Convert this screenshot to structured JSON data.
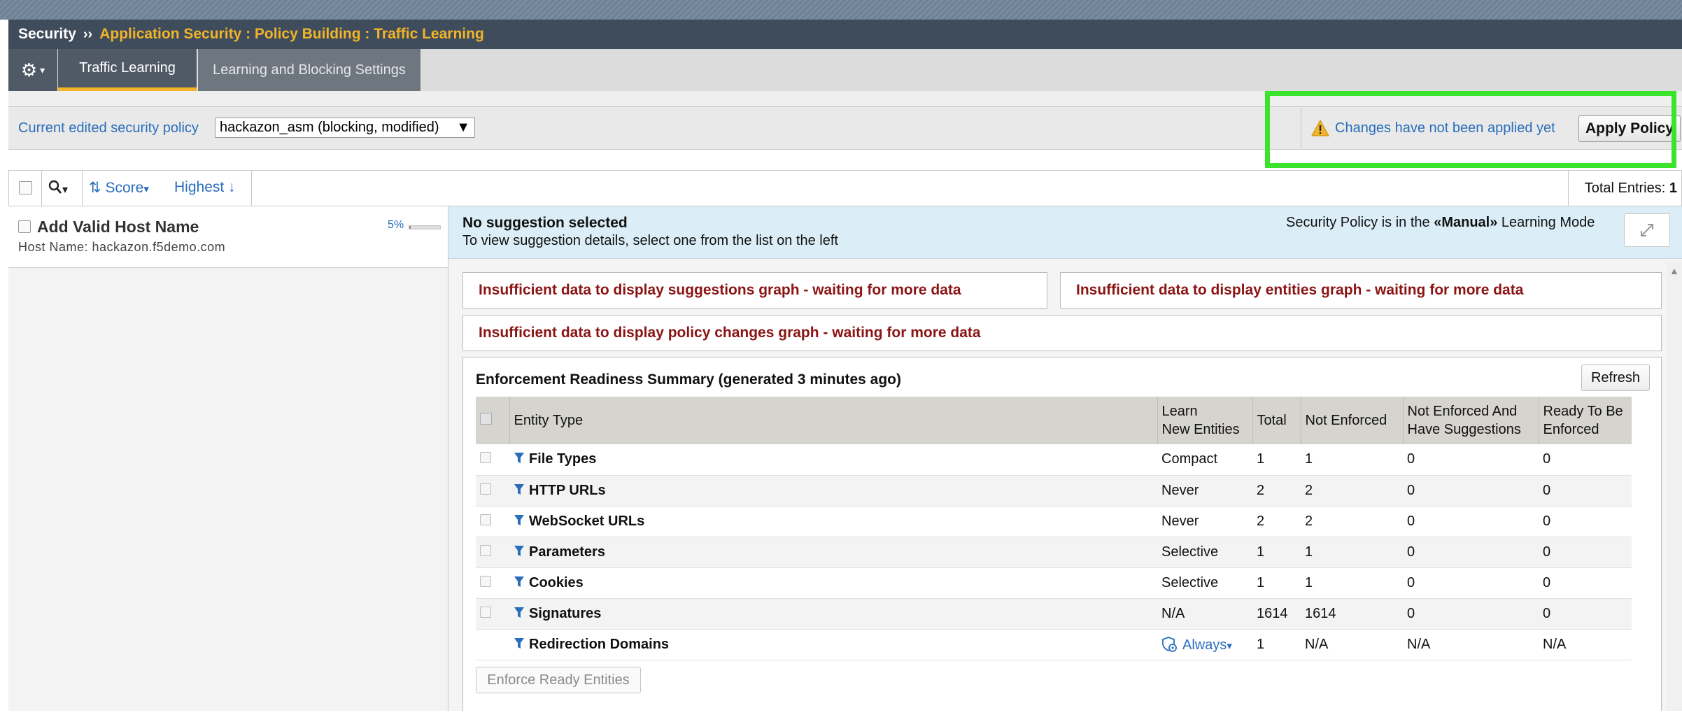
{
  "breadcrumb": {
    "root": "Security",
    "separator": "››",
    "path": "Application Security : Policy Building : Traffic Learning"
  },
  "tabs": [
    {
      "label": "Traffic Learning",
      "active": true
    },
    {
      "label": "Learning and Blocking Settings",
      "active": false
    }
  ],
  "gear_menu": {
    "icon": "gear-icon",
    "caret": "▾"
  },
  "policy_bar": {
    "label": "Current edited security policy",
    "selected_policy": "hackazon_asm (blocking, modified)",
    "select_arrow": "▼",
    "warning_icon": "warning-triangle-icon",
    "warning_text": "Changes have not been applied yet",
    "apply_button": "Apply Policy"
  },
  "toolbar": {
    "search_icon": "Q",
    "search_caret": "▾",
    "sort_label": "Score",
    "sort_caret": "▾",
    "order_label": "Highest",
    "order_arrow": "🡇",
    "total_label": "Total Entries:",
    "total_value": "1"
  },
  "suggestions": [
    {
      "title": "Add Valid Host Name",
      "subtitle": "Host Name: hackazon.f5demo.com",
      "score_pct": "5%",
      "score_fraction": 0.05
    }
  ],
  "suggestion_detail": {
    "title": "No suggestion selected",
    "subtitle": "To view suggestion details, select one from the list on the left",
    "mode_prefix": "Security Policy is in the ",
    "mode_value": "«Manual»",
    "mode_suffix": " Learning Mode",
    "expand_icon": "expand-icon"
  },
  "graph_notices": {
    "suggestions": "Insufficient data to display suggestions graph - waiting for more data",
    "entities": "Insufficient data to display entities graph - waiting for more data",
    "policy_changes": "Insufficient data to display policy changes graph - waiting for more data"
  },
  "readiness": {
    "title": "Enforcement Readiness Summary (generated 3 minutes ago)",
    "refresh_button": "Refresh",
    "columns": {
      "entity_type": "Entity Type",
      "learn_l1": "Learn",
      "learn_l2": "New Entities",
      "total": "Total",
      "not_enforced": "Not Enforced",
      "nea_l1": "Not Enforced And",
      "nea_l2": "Have Suggestions",
      "ready_l1": "Ready To Be",
      "ready_l2": "Enforced"
    },
    "rows": [
      {
        "entity": "File Types",
        "learn": "Compact",
        "total": "1",
        "not_enforced": "1",
        "with_suggestions": "0",
        "ready": "0"
      },
      {
        "entity": "HTTP URLs",
        "learn": "Never",
        "total": "2",
        "not_enforced": "2",
        "with_suggestions": "0",
        "ready": "0"
      },
      {
        "entity": "WebSocket URLs",
        "learn": "Never",
        "total": "2",
        "not_enforced": "2",
        "with_suggestions": "0",
        "ready": "0"
      },
      {
        "entity": "Parameters",
        "learn": "Selective",
        "total": "1",
        "not_enforced": "1",
        "with_suggestions": "0",
        "ready": "0"
      },
      {
        "entity": "Cookies",
        "learn": "Selective",
        "total": "1",
        "not_enforced": "1",
        "with_suggestions": "0",
        "ready": "0"
      },
      {
        "entity": "Signatures",
        "learn": "N/A",
        "total": "1614",
        "not_enforced": "1614",
        "with_suggestions": "0",
        "ready": "0"
      },
      {
        "entity": "Redirection Domains",
        "learn": "Always",
        "learn_caret": "▾",
        "total": "1",
        "not_enforced": "N/A",
        "with_suggestions": "N/A",
        "ready": "N/A"
      }
    ],
    "enforce_button": "Enforce Ready Entities"
  },
  "colors": {
    "breadcrumb_bg": "#3e4c5c",
    "accent_yellow": "#f2b429",
    "link_blue": "#2a6ebb",
    "notice_red": "#8b1414",
    "highlight_green": "#3be32d"
  }
}
